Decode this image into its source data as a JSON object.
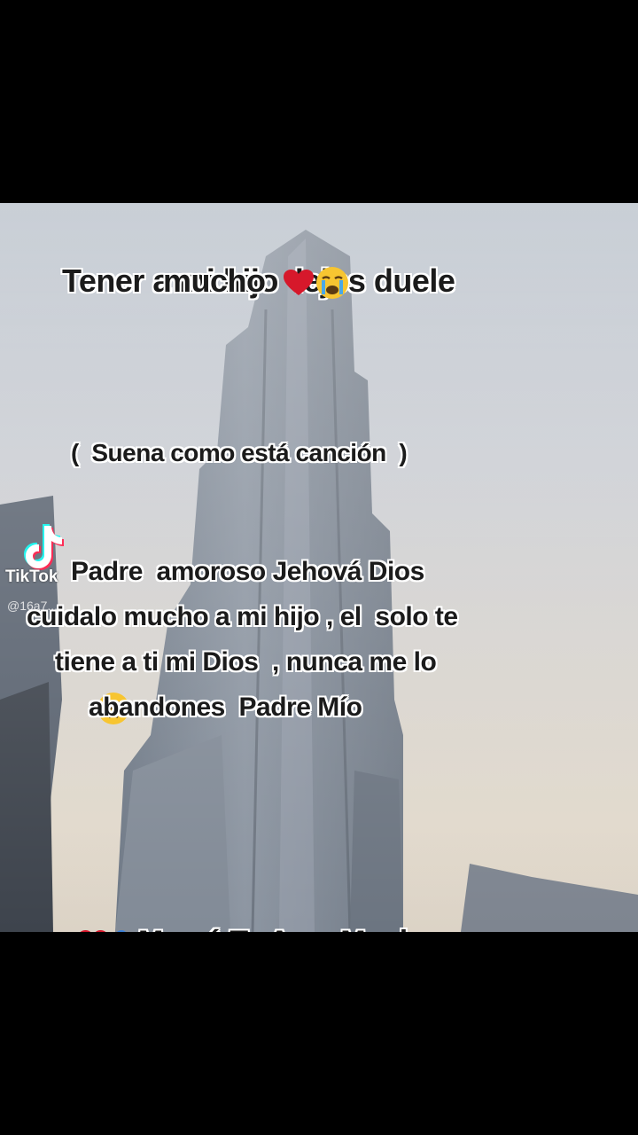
{
  "caption": {
    "title_line1": "Tener a mi hijo  lejos duele",
    "title_line2": "mucho",
    "song_note": "(  Suena como está canción  )",
    "prayer_lines": [
      "Padre  amoroso Jehová Dios",
      "cuidalo mucho a mi hijo , el  solo te",
      "tiene a ti mi Dios  , nunca me lo",
      "abandones  Padre Mío"
    ],
    "closing": "Mamá Te Ama Mucho"
  },
  "watermark": {
    "brand": "TikTok",
    "handle": "@16a7..."
  },
  "emojis": [
    "red-heart",
    "crying-face",
    "pleading-face",
    "red-heart",
    "people-hugging"
  ],
  "colors": {
    "letterbox": "#000000",
    "text": "#1b1b1b",
    "outline": "#ffffff",
    "heart": "#d6182b"
  }
}
